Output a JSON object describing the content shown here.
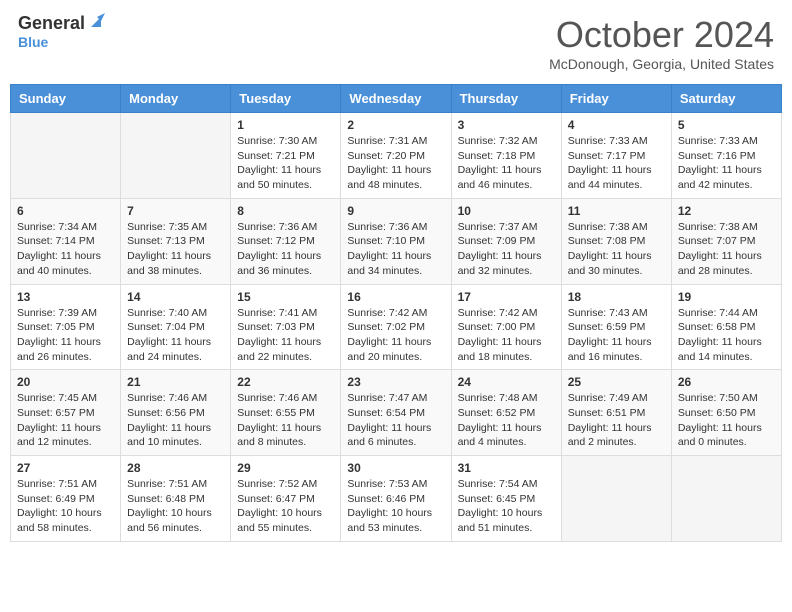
{
  "header": {
    "logo_general": "General",
    "logo_blue": "Blue",
    "month_title": "October 2024",
    "location": "McDonough, Georgia, United States"
  },
  "days_of_week": [
    "Sunday",
    "Monday",
    "Tuesday",
    "Wednesday",
    "Thursday",
    "Friday",
    "Saturday"
  ],
  "weeks": [
    [
      {
        "day": "",
        "info": ""
      },
      {
        "day": "",
        "info": ""
      },
      {
        "day": "1",
        "info": "Sunrise: 7:30 AM\nSunset: 7:21 PM\nDaylight: 11 hours and 50 minutes."
      },
      {
        "day": "2",
        "info": "Sunrise: 7:31 AM\nSunset: 7:20 PM\nDaylight: 11 hours and 48 minutes."
      },
      {
        "day": "3",
        "info": "Sunrise: 7:32 AM\nSunset: 7:18 PM\nDaylight: 11 hours and 46 minutes."
      },
      {
        "day": "4",
        "info": "Sunrise: 7:33 AM\nSunset: 7:17 PM\nDaylight: 11 hours and 44 minutes."
      },
      {
        "day": "5",
        "info": "Sunrise: 7:33 AM\nSunset: 7:16 PM\nDaylight: 11 hours and 42 minutes."
      }
    ],
    [
      {
        "day": "6",
        "info": "Sunrise: 7:34 AM\nSunset: 7:14 PM\nDaylight: 11 hours and 40 minutes."
      },
      {
        "day": "7",
        "info": "Sunrise: 7:35 AM\nSunset: 7:13 PM\nDaylight: 11 hours and 38 minutes."
      },
      {
        "day": "8",
        "info": "Sunrise: 7:36 AM\nSunset: 7:12 PM\nDaylight: 11 hours and 36 minutes."
      },
      {
        "day": "9",
        "info": "Sunrise: 7:36 AM\nSunset: 7:10 PM\nDaylight: 11 hours and 34 minutes."
      },
      {
        "day": "10",
        "info": "Sunrise: 7:37 AM\nSunset: 7:09 PM\nDaylight: 11 hours and 32 minutes."
      },
      {
        "day": "11",
        "info": "Sunrise: 7:38 AM\nSunset: 7:08 PM\nDaylight: 11 hours and 30 minutes."
      },
      {
        "day": "12",
        "info": "Sunrise: 7:38 AM\nSunset: 7:07 PM\nDaylight: 11 hours and 28 minutes."
      }
    ],
    [
      {
        "day": "13",
        "info": "Sunrise: 7:39 AM\nSunset: 7:05 PM\nDaylight: 11 hours and 26 minutes."
      },
      {
        "day": "14",
        "info": "Sunrise: 7:40 AM\nSunset: 7:04 PM\nDaylight: 11 hours and 24 minutes."
      },
      {
        "day": "15",
        "info": "Sunrise: 7:41 AM\nSunset: 7:03 PM\nDaylight: 11 hours and 22 minutes."
      },
      {
        "day": "16",
        "info": "Sunrise: 7:42 AM\nSunset: 7:02 PM\nDaylight: 11 hours and 20 minutes."
      },
      {
        "day": "17",
        "info": "Sunrise: 7:42 AM\nSunset: 7:00 PM\nDaylight: 11 hours and 18 minutes."
      },
      {
        "day": "18",
        "info": "Sunrise: 7:43 AM\nSunset: 6:59 PM\nDaylight: 11 hours and 16 minutes."
      },
      {
        "day": "19",
        "info": "Sunrise: 7:44 AM\nSunset: 6:58 PM\nDaylight: 11 hours and 14 minutes."
      }
    ],
    [
      {
        "day": "20",
        "info": "Sunrise: 7:45 AM\nSunset: 6:57 PM\nDaylight: 11 hours and 12 minutes."
      },
      {
        "day": "21",
        "info": "Sunrise: 7:46 AM\nSunset: 6:56 PM\nDaylight: 11 hours and 10 minutes."
      },
      {
        "day": "22",
        "info": "Sunrise: 7:46 AM\nSunset: 6:55 PM\nDaylight: 11 hours and 8 minutes."
      },
      {
        "day": "23",
        "info": "Sunrise: 7:47 AM\nSunset: 6:54 PM\nDaylight: 11 hours and 6 minutes."
      },
      {
        "day": "24",
        "info": "Sunrise: 7:48 AM\nSunset: 6:52 PM\nDaylight: 11 hours and 4 minutes."
      },
      {
        "day": "25",
        "info": "Sunrise: 7:49 AM\nSunset: 6:51 PM\nDaylight: 11 hours and 2 minutes."
      },
      {
        "day": "26",
        "info": "Sunrise: 7:50 AM\nSunset: 6:50 PM\nDaylight: 11 hours and 0 minutes."
      }
    ],
    [
      {
        "day": "27",
        "info": "Sunrise: 7:51 AM\nSunset: 6:49 PM\nDaylight: 10 hours and 58 minutes."
      },
      {
        "day": "28",
        "info": "Sunrise: 7:51 AM\nSunset: 6:48 PM\nDaylight: 10 hours and 56 minutes."
      },
      {
        "day": "29",
        "info": "Sunrise: 7:52 AM\nSunset: 6:47 PM\nDaylight: 10 hours and 55 minutes."
      },
      {
        "day": "30",
        "info": "Sunrise: 7:53 AM\nSunset: 6:46 PM\nDaylight: 10 hours and 53 minutes."
      },
      {
        "day": "31",
        "info": "Sunrise: 7:54 AM\nSunset: 6:45 PM\nDaylight: 10 hours and 51 minutes."
      },
      {
        "day": "",
        "info": ""
      },
      {
        "day": "",
        "info": ""
      }
    ]
  ]
}
